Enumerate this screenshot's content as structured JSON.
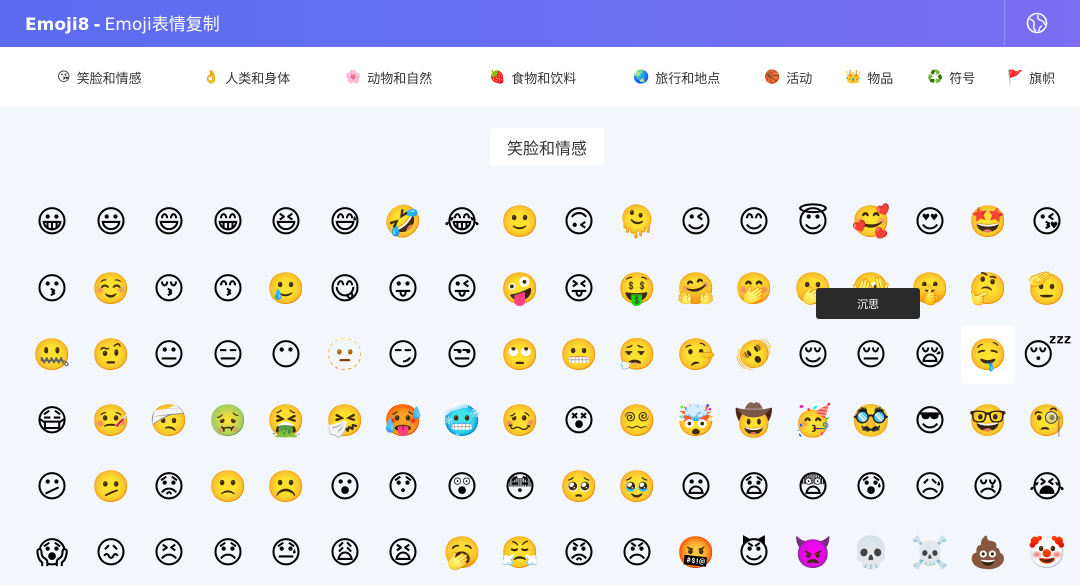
{
  "header": {
    "brand": "Emoji8",
    "separator": "-",
    "subtitle": "Emoji表情复制",
    "language_icon": "globe-icon"
  },
  "categories": [
    {
      "icon": "😘",
      "label": "笑脸和情感",
      "active": true
    },
    {
      "icon": "👌",
      "label": "人类和身体"
    },
    {
      "icon": "🌸",
      "label": "动物和自然"
    },
    {
      "icon": "🍓",
      "label": "食物和饮料"
    },
    {
      "icon": "🌏",
      "label": "旅行和地点"
    },
    {
      "icon": "🏀",
      "label": "活动"
    },
    {
      "icon": "👑",
      "label": "物品"
    },
    {
      "icon": "♻️",
      "label": "符号"
    },
    {
      "icon": "🚩",
      "label": "旗帜"
    }
  ],
  "section": {
    "title": "笑脸和情感"
  },
  "emoji_rows": [
    [
      "😀",
      "😃",
      "😄",
      "😁",
      "😆",
      "😅",
      "🤣",
      "😂",
      "🙂",
      "🙃",
      "🫠",
      "😉",
      "😊",
      "😇",
      "🥰",
      "😍",
      "🤩",
      "😘"
    ],
    [
      "😗",
      "☺️",
      "😚",
      "😙",
      "🥲",
      "😋",
      "😛",
      "😜",
      "🤪",
      "😝",
      "🤑",
      "🤗",
      "🤭",
      "🫢",
      "🫣",
      "🤫",
      "🤔",
      "🫡"
    ],
    [
      "🤐",
      "🤨",
      "😐",
      "😑",
      "😶",
      "🫥",
      "😶‍🌫️",
      "😏",
      "😒",
      "🙄",
      "😬",
      "😮‍💨",
      "🤥",
      "🫨",
      "😌",
      "😔",
      "😪",
      "🤤",
      "😴"
    ],
    [
      "😷",
      "🤒",
      "🤕",
      "🤢",
      "🤮",
      "🤧",
      "🥵",
      "🥶",
      "🥴",
      "😵",
      "😵‍💫",
      "🤯",
      "🤠",
      "🥳",
      "🥸",
      "😎",
      "🤓",
      "🧐"
    ],
    [
      "😕",
      "🫤",
      "😟",
      "🙁",
      "☹️",
      "😮",
      "😯",
      "😲",
      "😳",
      "🥺",
      "🥹",
      "😦",
      "😧",
      "😨",
      "😰",
      "😥",
      "😢",
      "😭"
    ],
    [
      "😱",
      "😖",
      "😣",
      "😞",
      "😓",
      "😩",
      "😫",
      "🥱",
      "😤",
      "😡",
      "😠",
      "🤬",
      "😈",
      "👿",
      "💀",
      "☠️",
      "💩",
      "🤡"
    ]
  ],
  "tooltip": {
    "text": "沉思"
  }
}
